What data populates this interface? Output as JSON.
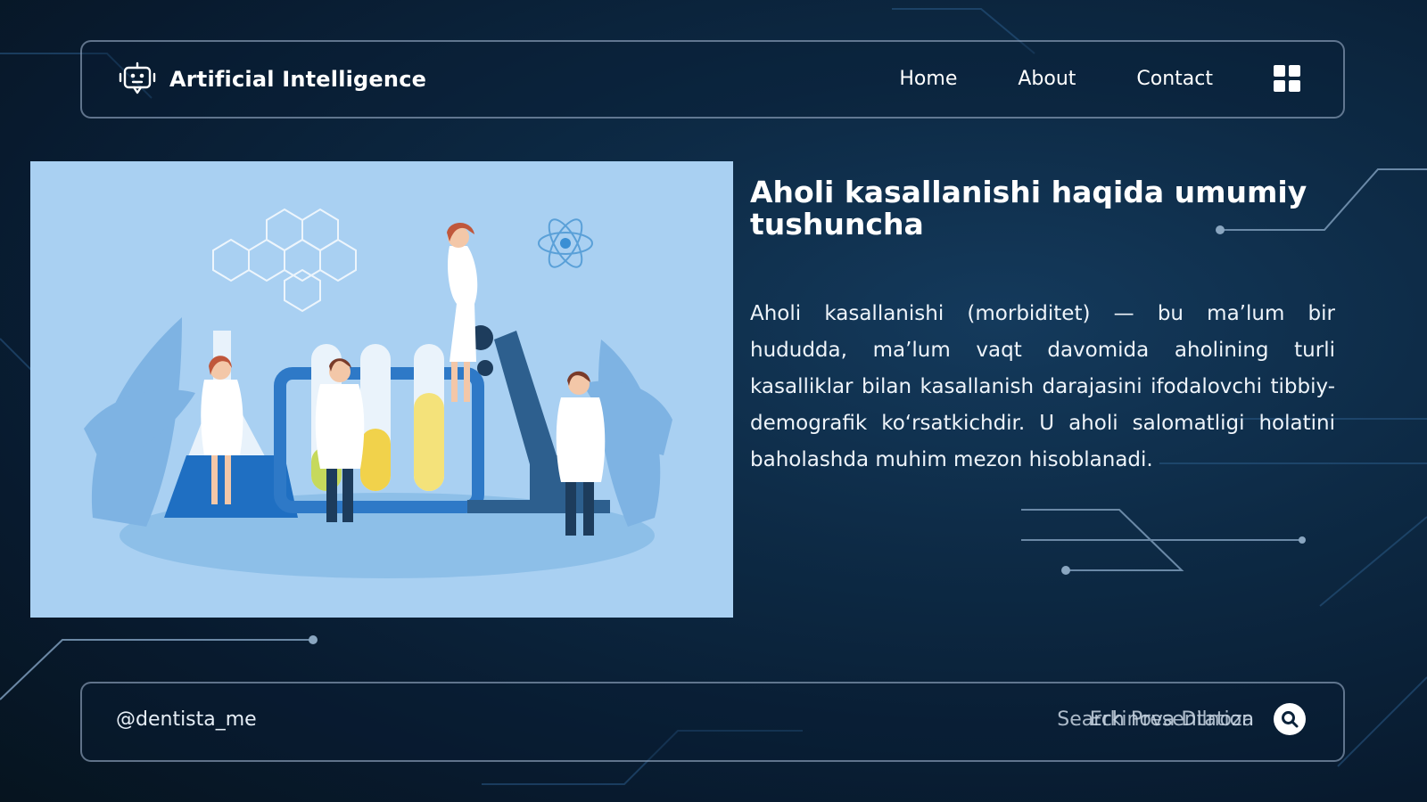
{
  "header": {
    "brand_icon": "robot-chat-icon",
    "brand_title": "Artificial Intelligence",
    "nav": [
      {
        "label": "Home"
      },
      {
        "label": "About"
      },
      {
        "label": "Contact"
      }
    ],
    "menu_icon": "grid-menu-icon"
  },
  "main": {
    "image_subject": "scientists-laboratory-illustration",
    "title": "Aholi kasallanishi haqida umumiy tushuncha",
    "body": "Aholi kasallanishi (morbiditet) — bu ma’lum bir hududda, ma’lum vaqt davomida aholining turli kasalliklar bilan kasallanish darajasini ifodalovchi tibbiy-demografik ko‘rsatkichdir. U aholi salomatligi holatini baholashda muhim mezon hisoblanadi."
  },
  "footer": {
    "handle": "@dentista_me",
    "author": "Erkinova Dilnoza",
    "search_placeholder": "Search Presentation",
    "search_icon": "search-icon"
  },
  "colors": {
    "background": "#0b223a",
    "accent": "#4a9fe0",
    "illustration_bg": "#a9d0f2",
    "text": "#ffffff"
  }
}
